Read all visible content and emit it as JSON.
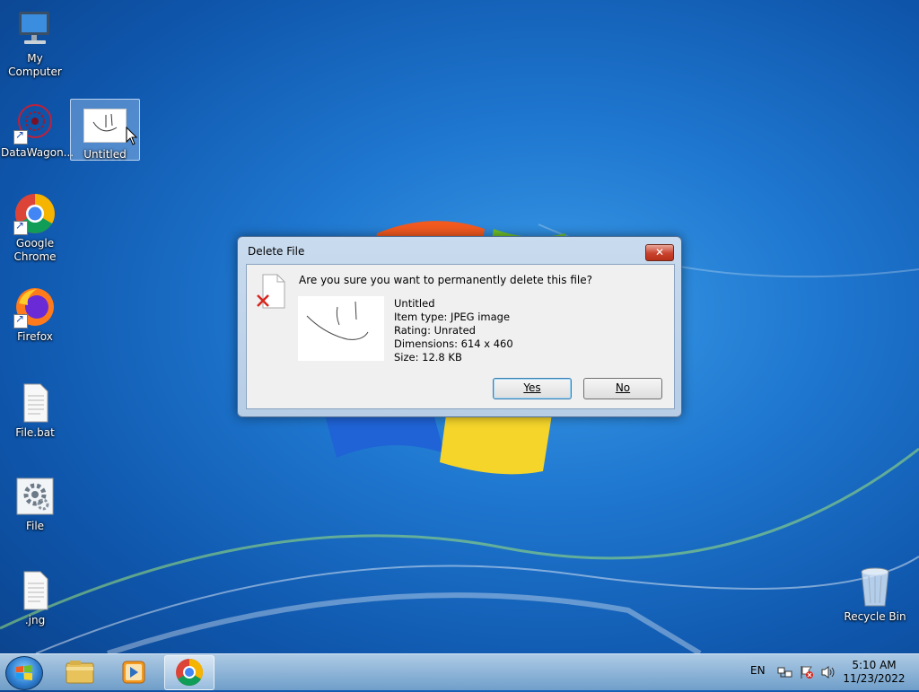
{
  "desktop": {
    "icons": [
      {
        "label": "My Computer"
      },
      {
        "label": "DataWagon..."
      },
      {
        "label": "Untitled"
      },
      {
        "label": "Google Chrome"
      },
      {
        "label": "Firefox"
      },
      {
        "label": "File.bat"
      },
      {
        "label": "File"
      },
      {
        "label": ".jng"
      },
      {
        "label": "Recycle Bin"
      }
    ]
  },
  "dialog": {
    "title": "Delete File",
    "close_label": "✕",
    "question": "Are you sure you want to permanently delete this file?",
    "file_name": "Untitled",
    "item_type": "Item type: JPEG image",
    "rating": "Rating: Unrated",
    "dimensions": "Dimensions: 614 x 460",
    "size": "Size: 12.8 KB",
    "yes_label": "Yes",
    "no_label": "No"
  },
  "taskbar": {
    "language": "EN",
    "time": "5:10 AM",
    "date": "11/23/2022",
    "pinned": [
      "file-explorer-icon",
      "media-player-icon",
      "chrome-icon"
    ]
  },
  "colors": {
    "desktop_accent": "#1f77cf",
    "close_button": "#c8422d"
  }
}
